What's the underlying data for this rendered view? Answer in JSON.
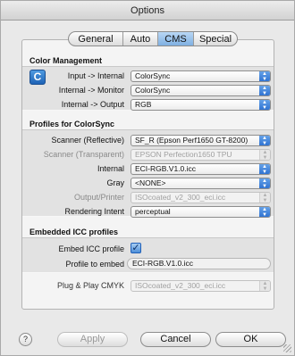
{
  "window": {
    "title": "Options"
  },
  "tabs": [
    {
      "label": "General",
      "selected": false
    },
    {
      "label": "Auto",
      "selected": false
    },
    {
      "label": "CMS",
      "selected": true
    },
    {
      "label": "Special",
      "selected": false
    }
  ],
  "color_management": {
    "title": "Color Management",
    "icon": "colorsync-icon",
    "rows": [
      {
        "label": "Input -> Internal",
        "value": "ColorSync"
      },
      {
        "label": "Internal -> Monitor",
        "value": "ColorSync"
      },
      {
        "label": "Internal -> Output",
        "value": "RGB"
      }
    ]
  },
  "profiles": {
    "title": "Profiles for ColorSync",
    "rows": [
      {
        "label": "Scanner (Reflective)",
        "value": "SF_R (Epson Perf1650 GT-8200)",
        "enabled": true
      },
      {
        "label": "Scanner (Transparent)",
        "value": "EPSON Perfection1650 TPU",
        "enabled": false
      },
      {
        "label": "Internal",
        "value": "ECI-RGB.V1.0.icc",
        "enabled": true
      },
      {
        "label": "Gray",
        "value": "<NONE>",
        "enabled": true
      },
      {
        "label": "Output/Printer",
        "value": "ISOcoated_v2_300_eci.icc",
        "enabled": false
      },
      {
        "label": "Rendering Intent",
        "value": "perceptual",
        "enabled": true
      }
    ]
  },
  "embedded": {
    "title": "Embedded ICC profiles",
    "embed_label": "Embed ICC profile",
    "embed_checked": true,
    "profile_label": "Profile to embed",
    "profile_value": "ECI-RGB.V1.0.icc",
    "pnp_label": "Plug & Play CMYK",
    "pnp_value": "ISOcoated_v2_300_eci.icc"
  },
  "buttons": {
    "help": "?",
    "apply": "Apply",
    "cancel": "Cancel",
    "ok": "OK"
  },
  "colors": {
    "accent": "#2b6fd0",
    "selected_tab": "#9fc4ee"
  }
}
